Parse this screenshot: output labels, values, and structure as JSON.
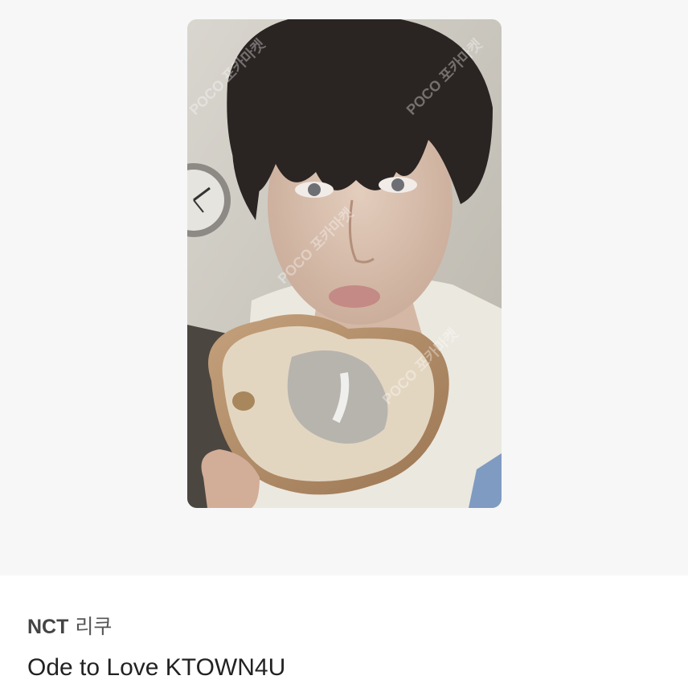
{
  "listing": {
    "group": "NCT",
    "member": "리쿠",
    "title": "Ode to Love KTOWN4U"
  },
  "photocard": {
    "watermark": "POCO 포카마켓",
    "background_color": "#f7f7f7",
    "subject": "person eating bread slice"
  }
}
